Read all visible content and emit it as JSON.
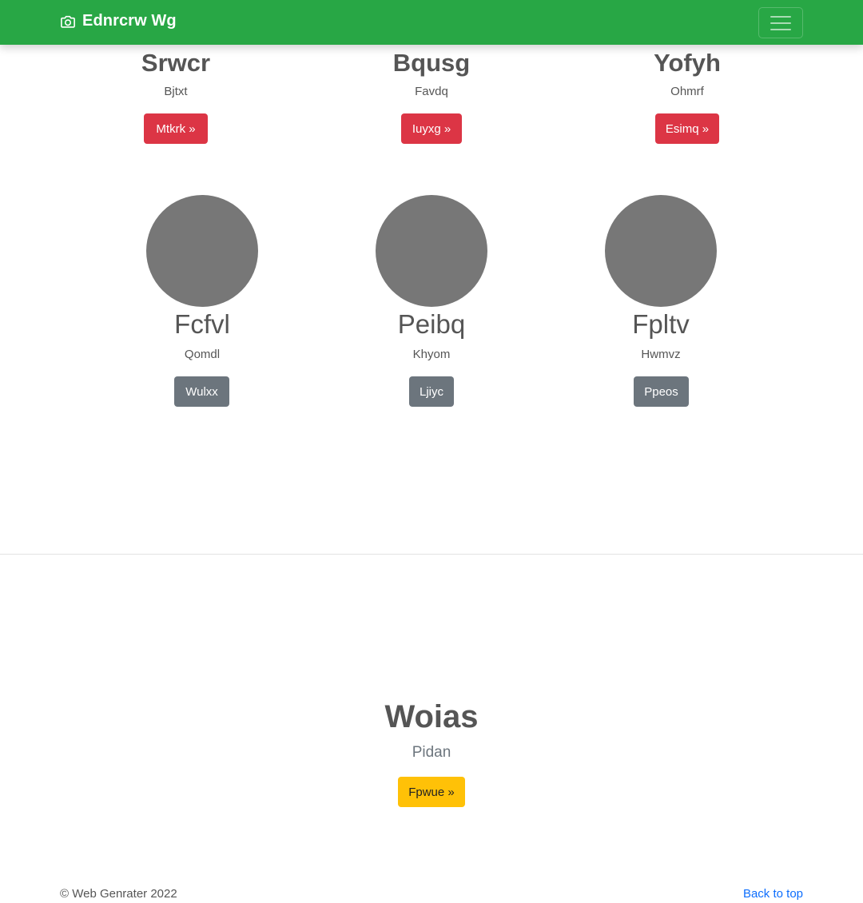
{
  "navbar": {
    "brand": "Ednrcrw Wg",
    "brand_icon": "camera-icon",
    "toggler_icon": "hamburger-icon",
    "color": "#28a745"
  },
  "top_row": [
    {
      "title": "Srwcr",
      "subtitle": "Bjtxt",
      "button": "Mtkrk »"
    },
    {
      "title": "Bqusg",
      "subtitle": "Favdq",
      "button": "Iuyxg »"
    },
    {
      "title": "Yofyh",
      "subtitle": "Ohmrf",
      "button": "Esimq »"
    }
  ],
  "profiles": [
    {
      "name": "Fcfvl",
      "subtitle": "Qomdl",
      "button": "Wulxx"
    },
    {
      "name": "Peibq",
      "subtitle": "Khyom",
      "button": "Ljiyc"
    },
    {
      "name": "Fpltv",
      "subtitle": "Hwmvz",
      "button": "Ppeos"
    }
  ],
  "feature": {
    "title": "Woias",
    "lead": "Pidan",
    "button": "Fpwue »"
  },
  "footer": {
    "copyright": "© Web Genrater 2022",
    "back_to_top": "Back to top"
  },
  "colors": {
    "danger": "#dc3545",
    "secondary": "#6c757d",
    "warning": "#ffc107",
    "link": "#0d6efd",
    "avatar_placeholder": "#777777"
  }
}
